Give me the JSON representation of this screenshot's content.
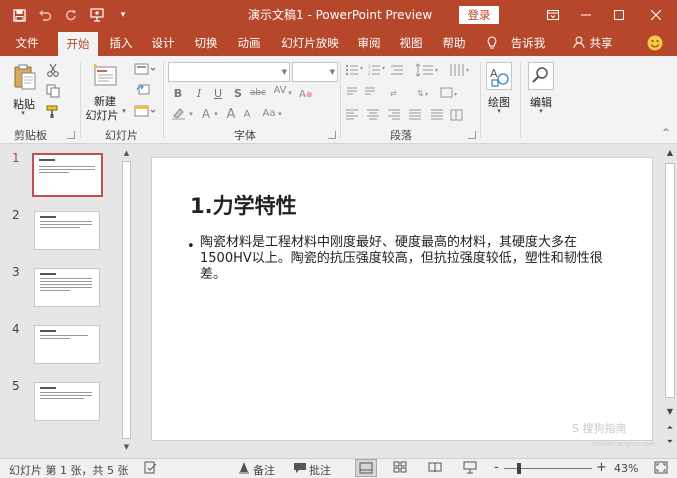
{
  "titlebar": {
    "doc_title": "演示文稿1  -  PowerPoint Preview",
    "login_label": "登录",
    "save_icon": "save-icon",
    "undo_icon": "undo-icon",
    "redo_icon": "redo-icon",
    "present_icon": "present-from-beginning-icon",
    "customize_icon": "customize-qat-icon"
  },
  "tabs": [
    "文件",
    "开始",
    "插入",
    "设计",
    "切换",
    "动画",
    "幻灯片放映",
    "审阅",
    "视图",
    "帮助",
    "告诉我",
    "共享"
  ],
  "active_tab": "开始",
  "ribbon": {
    "clipboard": {
      "paste": "粘贴",
      "group": "剪贴板"
    },
    "slides": {
      "new_slide_line1": "新建",
      "new_slide_line2": "幻灯片",
      "group": "幻灯片"
    },
    "font": {
      "group": "字体",
      "bold": "B",
      "italic": "I",
      "underline": "U",
      "shadow": "S",
      "strike": "abc",
      "spacing": "AV",
      "font_color": "A",
      "size_up": "A",
      "size_down": "A",
      "case": "Aa"
    },
    "paragraph": {
      "group": "段落"
    },
    "drawing": {
      "label": "绘图"
    },
    "editing": {
      "label": "编辑"
    }
  },
  "thumbnails": [
    {
      "number": "1",
      "selected": true
    },
    {
      "number": "2",
      "selected": false
    },
    {
      "number": "3",
      "selected": false
    },
    {
      "number": "4",
      "selected": false
    },
    {
      "number": "5",
      "selected": false
    }
  ],
  "slide": {
    "title": "1.力学特性",
    "bullet": "•",
    "body": "陶瓷材料是工程材料中刚度最好、硬度最高的材料，其硬度大多在1500HV以上。陶瓷的抗压强度较高，但抗拉强度较低，塑性和韧性很差。"
  },
  "status": {
    "slide_info": "幻灯片 第 1 张，共 5 张",
    "notes": "备注",
    "comments": "批注",
    "zoom": "43%",
    "zoom_minus": "-",
    "zoom_plus": "+"
  },
  "watermark": {
    "line1": "S 搜狗指南",
    "line2": "zhinan.sogou.com"
  },
  "colors": {
    "accent": "#b7472a",
    "selected_thumb": "#c0504d"
  }
}
